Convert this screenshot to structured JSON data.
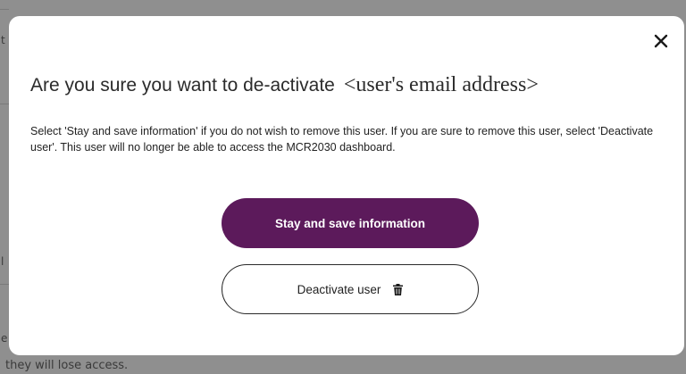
{
  "background": {
    "edge_chars": [
      "t",
      "l",
      "e"
    ],
    "bottom_text": "they will lose access."
  },
  "modal": {
    "close_icon": "close-icon",
    "title": "Are you sure you want to de-activate",
    "title_email": "<user's email address>",
    "body": "Select 'Stay and save information' if you do not wish to remove this user.  If you are sure to remove this user, select 'Deactivate user'. This user will no longer be able to access the MCR2030 dashboard.",
    "primary_button": "Stay and save information",
    "secondary_button": "Deactivate user",
    "secondary_icon": "trash-icon"
  },
  "colors": {
    "primary": "#5c1a5b",
    "overlay": "#8f8f8f",
    "surface": "#ffffff",
    "text": "#222222"
  }
}
